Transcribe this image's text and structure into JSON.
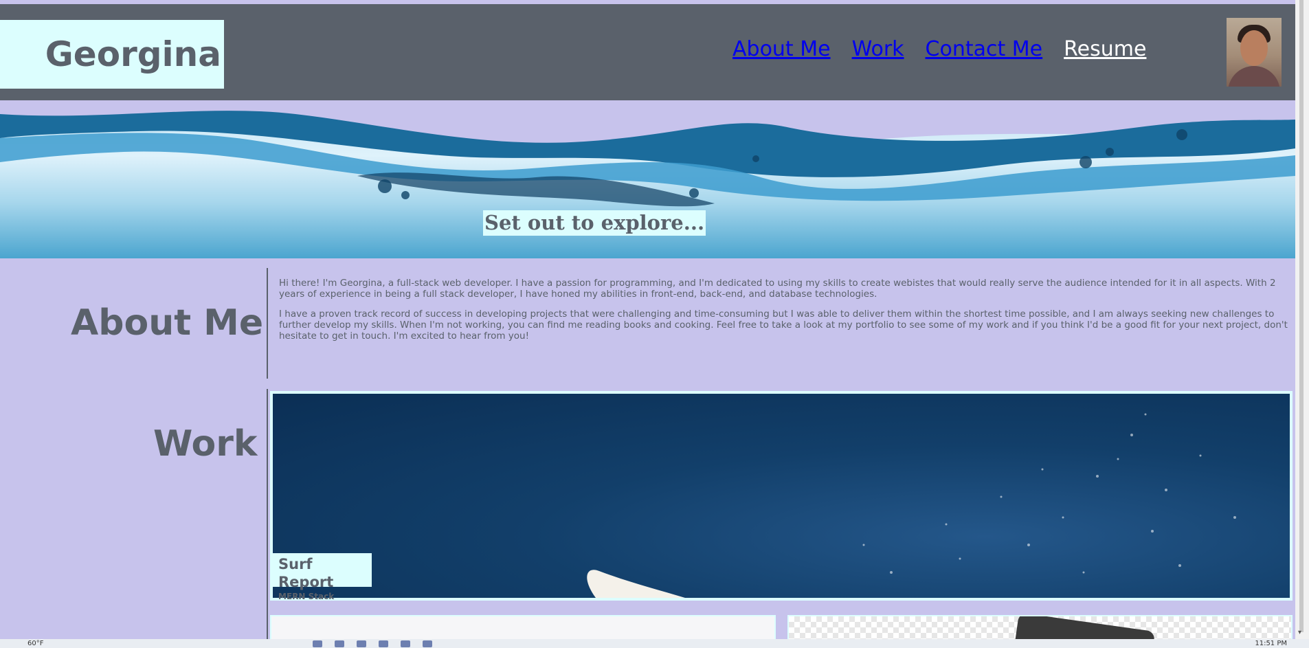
{
  "header": {
    "brand": "Georgina",
    "nav": [
      "About Me",
      "Work",
      "Contact Me",
      "Resume"
    ]
  },
  "hero": {
    "tagline": "Set out to explore..."
  },
  "about": {
    "title": "About Me",
    "paragraphs": [
      "Hi there! I'm Georgina, a full-stack web developer. I have a passion for programming, and I'm dedicated to using my skills to create webistes that would really serve the audience intended for it in all aspects. With 2 years of experience in being a full stack developer, I have honed my abilities in front-end, back-end, and database technologies.",
      "I have a proven track record of success in developing projects that were challenging and time-consuming but I was able to deliver them within the shortest time possible, and I am always seeking new challenges to further develop my skills. When I'm not working, you can find me reading books and cooking. Feel free to take a look at my portfolio to see some of my work and if you think I'd be a good fit for your next project, don't hesitate to get in touch. I'm excited to hear from you!"
    ]
  },
  "work": {
    "title": "Work",
    "projects": [
      {
        "title": "Surf Report",
        "subtitle": "MERN Stack"
      }
    ]
  },
  "taskbar": {
    "weather": "60°F",
    "time": "11:51 PM"
  },
  "colors": {
    "page_bg": "#c7c3ec",
    "header_bg": "#5a616b",
    "accent_light": "#dcfefe",
    "text": "#5a616b",
    "link": "#0000ee"
  }
}
